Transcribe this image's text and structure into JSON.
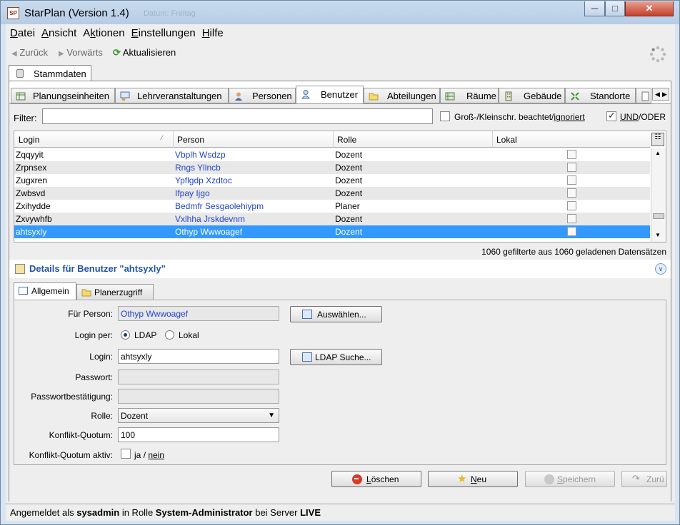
{
  "window": {
    "title": "StarPlan (Version 1.4)",
    "ghost_title": "Datum: Freitag"
  },
  "menu": [
    {
      "pre": "",
      "ul": "D",
      "post": "atei"
    },
    {
      "pre": "",
      "ul": "A",
      "post": "nsicht"
    },
    {
      "pre": "A",
      "ul": "k",
      "post": "tionen"
    },
    {
      "pre": "",
      "ul": "E",
      "post": "instellungen"
    },
    {
      "pre": "",
      "ul": "H",
      "post": "ilfe"
    }
  ],
  "nav": {
    "back": "Zurück",
    "forward": "Vorwärts",
    "refresh": "Aktualisieren"
  },
  "main_tab": "Stammdaten",
  "tabs": [
    "Planungseinheiten",
    "Lehrveranstaltungen",
    "Personen",
    "Benutzer",
    "Abteilungen",
    "Räume",
    "Gebäude",
    "Standorte"
  ],
  "filter": {
    "label": "Filter:",
    "value": "",
    "case_label_a": "Groß-/Kleinschr. beachtet/",
    "case_label_b": "ignoriert",
    "und": "UND",
    "oder": "/ODER"
  },
  "grid": {
    "columns": [
      "Login",
      "Person",
      "Rolle",
      "Lokal"
    ],
    "rows": [
      {
        "login": "Zqqyyit",
        "person": "Vbplh Wsdzp",
        "role": "Dozent",
        "local": false
      },
      {
        "login": "Zrpnsex",
        "person": "Rngs Yllncb",
        "role": "Dozent",
        "local": false
      },
      {
        "login": "Zugxren",
        "person": "Ypflgdp Xzdtoc",
        "role": "Dozent",
        "local": false
      },
      {
        "login": "Zwbsvd",
        "person": "Ifpay Ijgo",
        "role": "Dozent",
        "local": false
      },
      {
        "login": "Zxihydde",
        "person": "Bedmfr Sesgaolehiypm",
        "role": "Planer",
        "local": false
      },
      {
        "login": "Zxvywhfb",
        "person": "Vxlhha Jrskdevnm",
        "role": "Dozent",
        "local": false
      },
      {
        "login": "ahtsyxly",
        "person": "Othyp Wwwoagef",
        "role": "Dozent",
        "local": false
      }
    ],
    "selected_row": 6,
    "count": "1060 gefilterte aus 1060 geladenen Datensätzen"
  },
  "details": {
    "title": "Details für Benutzer \"ahtsyxly\"",
    "tabs": [
      "Allgemein",
      "Planerzugriff"
    ],
    "labels": {
      "person": "Für Person:",
      "login_per": "Login per:",
      "login": "Login:",
      "password": "Passwort:",
      "password_confirm": "Passwortbestätigung:",
      "role": "Rolle:",
      "quota": "Konflikt-Quotum:",
      "quota_active": "Konflikt-Quotum aktiv:"
    },
    "person": "Othyp Wwwoagef",
    "login_methods": [
      "LDAP",
      "Lokal"
    ],
    "login": "ahtsyxly",
    "password": "",
    "password_confirm": "",
    "role": "Dozent",
    "quota": "100",
    "quota_active_ja": "ja",
    "quota_active_sep": "/",
    "quota_active_nein": "nein",
    "select_button": "Auswählen...",
    "ldap_button": "LDAP Suche..."
  },
  "actions": {
    "delete_ul": "L",
    "delete_rest": "öschen",
    "new_ul": "N",
    "new_rest": "eu",
    "save_ul": "S",
    "save_rest": "peichern",
    "back": "Zurü"
  },
  "status": {
    "pre": "Angemeldet als ",
    "user": "sysadmin",
    "mid": " in Rolle ",
    "role": "System-Administrator",
    "mid2": " bei Server ",
    "server": "LIVE"
  }
}
